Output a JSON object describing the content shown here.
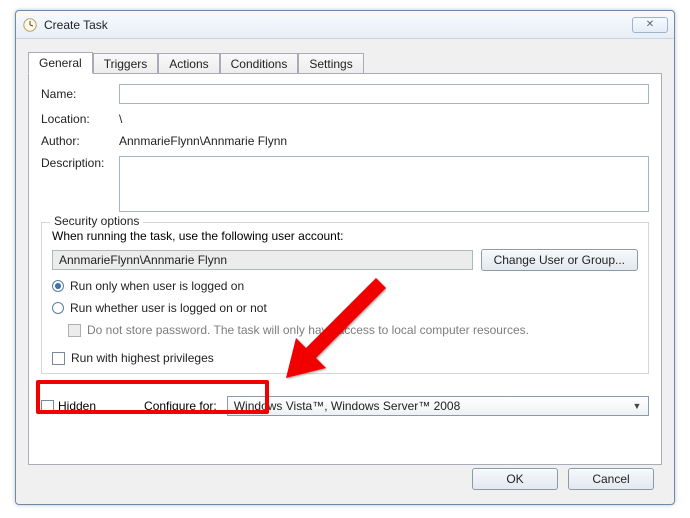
{
  "window": {
    "title": "Create Task"
  },
  "tabs": [
    "General",
    "Triggers",
    "Actions",
    "Conditions",
    "Settings"
  ],
  "general": {
    "labels": {
      "name": "Name:",
      "location": "Location:",
      "author": "Author:",
      "description": "Description:"
    },
    "name": "",
    "location": "\\",
    "author": "AnnmarieFlynn\\Annmarie Flynn",
    "description": ""
  },
  "security": {
    "legend": "Security options",
    "intro": "When running the task, use the following user account:",
    "account": "AnnmarieFlynn\\Annmarie Flynn",
    "change_btn": "Change User or Group...",
    "radio_logged_on": "Run only when user is logged on",
    "radio_any": "Run whether user is logged on or not",
    "store_pw": "Do not store password.  The task will only have access to local computer resources.",
    "highest": "Run with highest privileges"
  },
  "bottom": {
    "hidden": "Hidden",
    "configure_for": "Configure for:",
    "configure_value": "Windows Vista™, Windows Server™ 2008"
  },
  "buttons": {
    "ok": "OK",
    "cancel": "Cancel"
  }
}
